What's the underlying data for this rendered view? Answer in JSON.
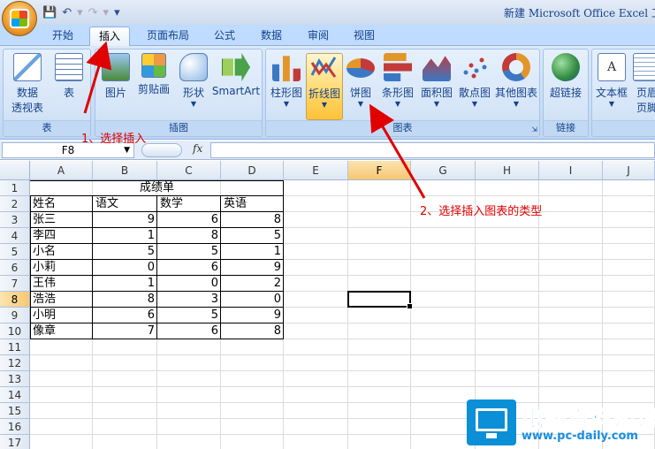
{
  "window": {
    "title": "新建 Microsoft Office Excel 工"
  },
  "quick_access": {
    "save_icon": "save-icon",
    "undo_icon": "undo-icon",
    "redo_icon": "redo-icon",
    "customize_icon": "chevron-down-icon"
  },
  "tabs": [
    {
      "label": "开始"
    },
    {
      "label": "插入"
    },
    {
      "label": "页面布局"
    },
    {
      "label": "公式"
    },
    {
      "label": "数据"
    },
    {
      "label": "审阅"
    },
    {
      "label": "视图"
    }
  ],
  "ribbon": {
    "groups": {
      "table": {
        "label": "表",
        "buttons": [
          {
            "label_line1": "数据",
            "label_line2": "透视表"
          },
          {
            "label": "表"
          }
        ]
      },
      "illustrations": {
        "label": "插图",
        "buttons": [
          {
            "label": "图片"
          },
          {
            "label": "剪贴画"
          },
          {
            "label": "形状"
          },
          {
            "label": "SmartArt"
          }
        ]
      },
      "charts": {
        "label": "图表",
        "buttons": [
          {
            "label": "柱形图"
          },
          {
            "label": "折线图"
          },
          {
            "label": "饼图"
          },
          {
            "label": "条形图"
          },
          {
            "label": "面积图"
          },
          {
            "label": "散点图"
          },
          {
            "label": "其他图表"
          }
        ]
      },
      "links": {
        "label": "链接",
        "buttons": [
          {
            "label": "超链接"
          }
        ]
      },
      "text": {
        "label": "",
        "buttons": [
          {
            "label": "文本框"
          },
          {
            "label_line1": "页眉",
            "label_line2": "页脚"
          }
        ]
      }
    }
  },
  "formula_bar": {
    "name_box": "F8",
    "fx": "fx",
    "value": ""
  },
  "sheet": {
    "columns": [
      "A",
      "B",
      "C",
      "D",
      "E",
      "F",
      "G",
      "H",
      "I",
      "J"
    ],
    "rows": [
      "1",
      "2",
      "3",
      "4",
      "5",
      "6",
      "7",
      "8",
      "9",
      "10",
      "11",
      "12",
      "13",
      "14",
      "15",
      "16",
      "17"
    ],
    "title": "成绩单",
    "header": [
      "姓名",
      "语文",
      "数学",
      "英语"
    ],
    "data": [
      [
        "张三",
        "9",
        "6",
        "8"
      ],
      [
        "李四",
        "1",
        "8",
        "5"
      ],
      [
        "小名",
        "5",
        "5",
        "1"
      ],
      [
        "小莉",
        "0",
        "6",
        "9"
      ],
      [
        "王伟",
        "1",
        "0",
        "2"
      ],
      [
        "浩浩",
        "8",
        "3",
        "0"
      ],
      [
        "小明",
        "6",
        "5",
        "9"
      ],
      [
        "像章",
        "7",
        "6",
        "8"
      ]
    ],
    "active_cell": "F8"
  },
  "annotations": {
    "step1": "1、选择插入",
    "step2": "2、选择插入图表的类型"
  },
  "watermark": {
    "title": "电脑百科知识",
    "url": "www.pc-daily.com"
  },
  "colors": {
    "ribbon_bg": "#c9dcf3",
    "tab_text": "#15428b",
    "annotation": "#e00000",
    "highlight": "#ffd767"
  }
}
